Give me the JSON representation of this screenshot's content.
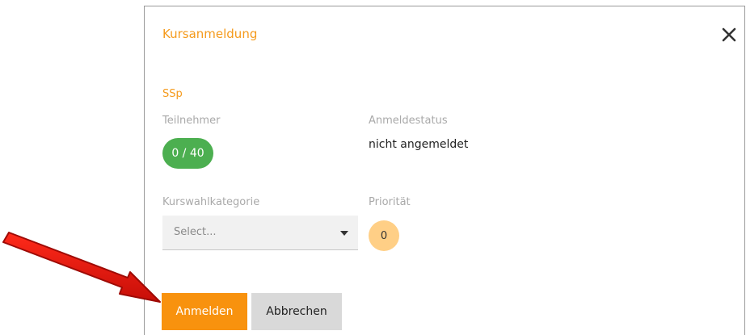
{
  "dialog": {
    "title": "Kursanmeldung",
    "close_icon": "close-icon"
  },
  "course": {
    "name": "SSp"
  },
  "participants": {
    "label": "Teilnehmer",
    "value": "0 / 40"
  },
  "status": {
    "label": "Anmeldestatus",
    "value": "nicht angemeldet"
  },
  "category": {
    "label": "Kurswahlkategorie",
    "placeholder": "Select..."
  },
  "priority": {
    "label": "Priorität",
    "value": "0"
  },
  "buttons": {
    "register": "Anmelden",
    "cancel": "Abbrechen"
  },
  "colors": {
    "accent": "#f8920e",
    "title": "#f59a1b",
    "participants_badge": "#4caf50",
    "priority_badge": "#ffcf86",
    "annotation_arrow": "#e8150e"
  }
}
